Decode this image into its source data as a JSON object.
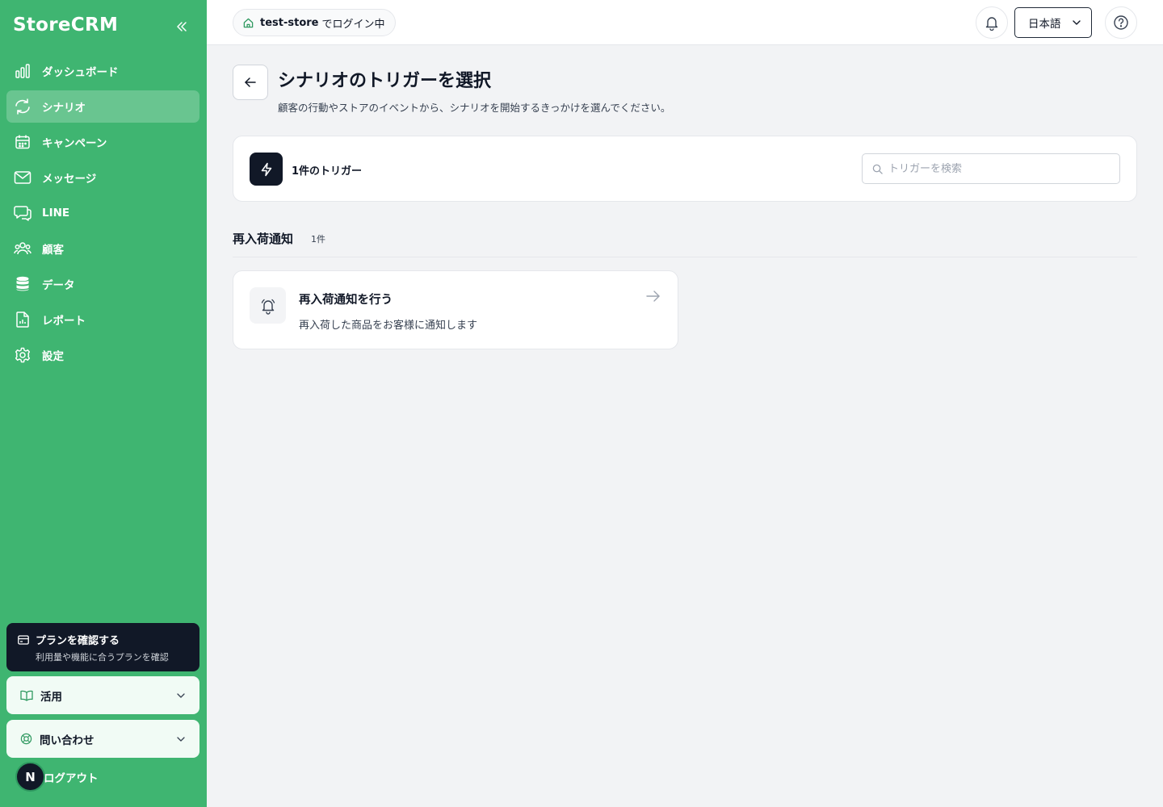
{
  "sidebar": {
    "brand": "StoreCRM",
    "items": [
      {
        "label": "ダッシュボード",
        "icon": "bar-chart-icon",
        "active": false
      },
      {
        "label": "シナリオ",
        "icon": "refresh-icon",
        "active": true
      },
      {
        "label": "キャンペーン",
        "icon": "calendar-icon",
        "active": false
      },
      {
        "label": "メッセージ",
        "icon": "mail-icon",
        "active": false
      },
      {
        "label": "LINE",
        "icon": "chat-icon",
        "active": false
      },
      {
        "label": "顧客",
        "icon": "users-icon",
        "active": false
      },
      {
        "label": "データ",
        "icon": "database-icon",
        "active": false
      },
      {
        "label": "レポート",
        "icon": "file-icon",
        "active": false
      },
      {
        "label": "設定",
        "icon": "gear-icon",
        "active": false
      }
    ],
    "plan": {
      "title": "プランを確認する",
      "subtitle": "利用量や機能に合うプランを確認"
    },
    "accordions": [
      {
        "label": "活用",
        "icon": "book-icon"
      },
      {
        "label": "問い合わせ",
        "icon": "lifebuoy-icon"
      }
    ],
    "avatar_letter": "N",
    "logout_label": "ログアウト"
  },
  "topbar": {
    "store_name": "test-store",
    "store_suffix": "でログイン中",
    "language": "日本語"
  },
  "main": {
    "title": "シナリオのトリガーを選択",
    "description": "顧客の行動やストアのイベントから、シナリオを開始するきっかけを選んでください。",
    "trigger_count": "1件のトリガー",
    "search_placeholder": "トリガーを検索",
    "search_value": "",
    "sections": [
      {
        "title": "再入荷通知",
        "count": "1件",
        "triggers": [
          {
            "title": "再入荷通知を行う",
            "description": "再入荷した商品をお客様に通知します",
            "icon": "bell-icon"
          }
        ]
      }
    ]
  },
  "colors": {
    "sidebar_bg": "#3fb571",
    "dark": "#111827",
    "page_bg": "#f2f3f5"
  }
}
